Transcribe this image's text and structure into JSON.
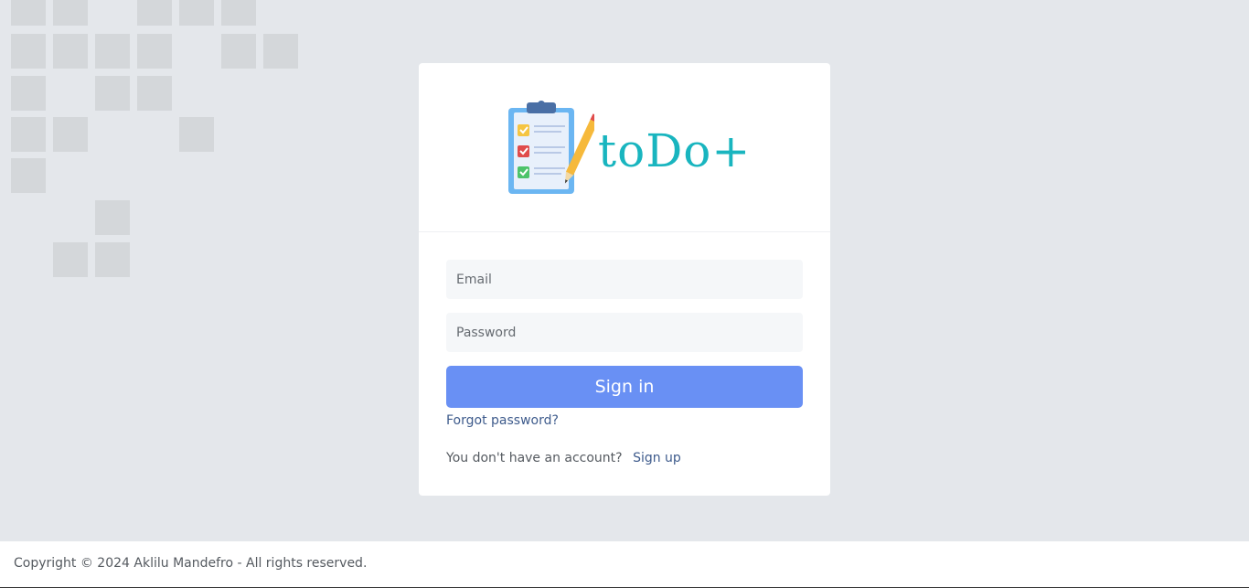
{
  "brand": {
    "name": "toDo+",
    "logo_icon": "clipboard-checklist-pencil",
    "accent": "#19b5bf"
  },
  "form": {
    "email_placeholder": "Email",
    "password_placeholder": "Password",
    "signin_label": "Sign in",
    "forgot_label": "Forgot password?",
    "no_account_text": "You don't have an account?",
    "signup_label": "Sign up",
    "button_color": "#6990f4"
  },
  "footer": {
    "copyright": "Copyright © 2024 Aklilu Mandefro - All rights reserved."
  }
}
